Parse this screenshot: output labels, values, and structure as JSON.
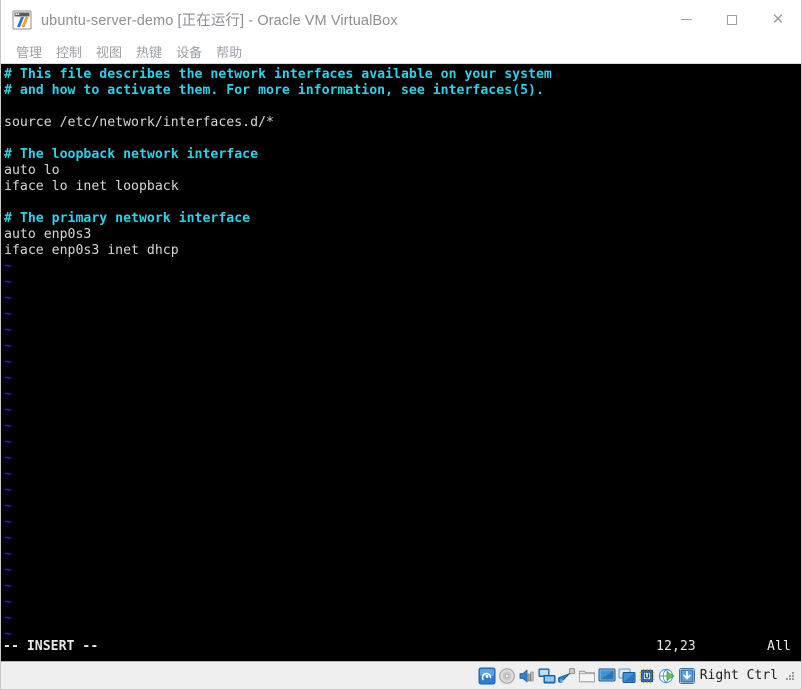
{
  "window": {
    "title": "ubuntu-server-demo [正在运行] - Oracle VM VirtualBox",
    "icon_name": "virtualbox-icon",
    "controls": {
      "minimize_label": "—",
      "maximize_label": "▢",
      "close_label": "✕"
    }
  },
  "menubar": {
    "items": [
      {
        "label": "管理",
        "name": "menu-manage"
      },
      {
        "label": "控制",
        "name": "menu-control"
      },
      {
        "label": "视图",
        "name": "menu-view"
      },
      {
        "label": "热键",
        "name": "menu-hotkey"
      },
      {
        "label": "设备",
        "name": "menu-devices"
      },
      {
        "label": "帮助",
        "name": "menu-help"
      }
    ]
  },
  "terminal": {
    "editor": "vim",
    "file_lines": [
      {
        "text": "# This file describes the network interfaces available on your system",
        "kind": "comment"
      },
      {
        "text": "# and how to activate them. For more information, see interfaces(5).",
        "kind": "comment"
      },
      {
        "text": "",
        "kind": "blank"
      },
      {
        "text": "source /etc/network/interfaces.d/*",
        "kind": "text"
      },
      {
        "text": "",
        "kind": "blank"
      },
      {
        "text": "# The loopback network interface",
        "kind": "comment"
      },
      {
        "text": "auto lo",
        "kind": "text"
      },
      {
        "text": "iface lo inet loopback",
        "kind": "text"
      },
      {
        "text": "",
        "kind": "blank"
      },
      {
        "text": "# The primary network interface",
        "kind": "comment"
      },
      {
        "text": "auto enp0s3",
        "kind": "text"
      },
      {
        "text": "iface enp0s3 inet dhcp",
        "kind": "text"
      }
    ],
    "empty_marker": "~",
    "empty_line_count": 24,
    "status": {
      "mode": "-- INSERT --",
      "position": "12,23",
      "scroll": "All"
    },
    "colors": {
      "background": "#000000",
      "foreground": "#d8d8d8",
      "comment": "#2fd0e8",
      "tilde": "#2020d8"
    }
  },
  "vbox_status_bar": {
    "icons": [
      {
        "name": "hard-disk-icon",
        "tooltip": "硬盘"
      },
      {
        "name": "optical-disk-icon",
        "tooltip": "光驱"
      },
      {
        "name": "audio-icon",
        "tooltip": "声卡"
      },
      {
        "name": "network-adapter-icon",
        "tooltip": "网络"
      },
      {
        "name": "usb-icon",
        "tooltip": "USB"
      },
      {
        "name": "shared-folder-icon",
        "tooltip": "共享文件夹"
      },
      {
        "name": "display-icon",
        "tooltip": "显示"
      },
      {
        "name": "recording-icon",
        "tooltip": "录制"
      },
      {
        "name": "cpu-icon",
        "tooltip": "处理器"
      },
      {
        "name": "remote-display-icon",
        "tooltip": "远程桌面"
      },
      {
        "name": "host-key-indicator-icon",
        "tooltip": "主机键"
      }
    ],
    "host_key_label": "Right Ctrl",
    "resize_grip_name": "resize-grip"
  }
}
